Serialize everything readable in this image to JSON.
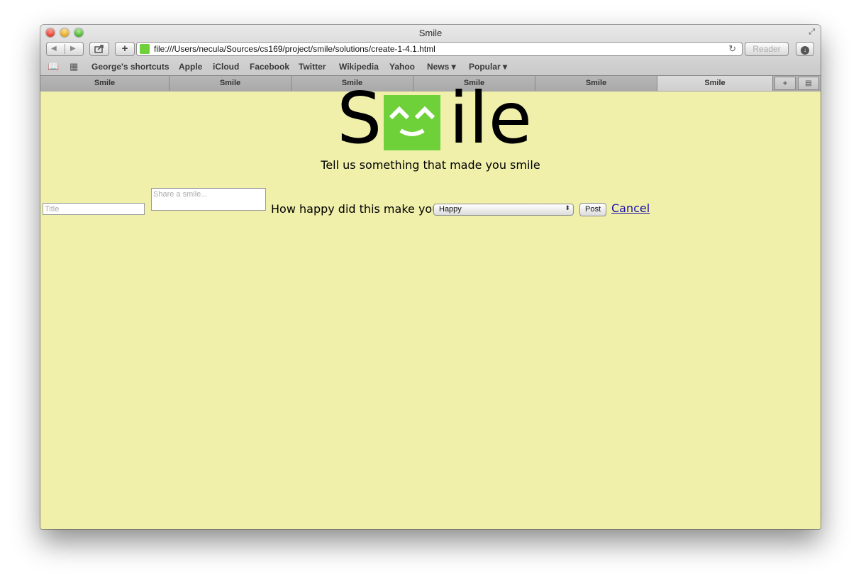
{
  "window": {
    "title": "Smile"
  },
  "toolbar": {
    "url": "file:///Users/necula/Sources/cs169/project/smile/solutions/create-1-4.1.html",
    "reader_label": "Reader"
  },
  "bookmarks": [
    "George's shortcuts",
    "Apple",
    "iCloud",
    "Facebook",
    "Twitter",
    "Wikipedia",
    "Yahoo",
    "News ▾",
    "Popular ▾"
  ],
  "tabs": [
    "Smile",
    "Smile",
    "Smile",
    "Smile",
    "Smile",
    "Smile"
  ],
  "page": {
    "logo_left": "S",
    "logo_right": "ile",
    "subtitle": "Tell us something that made you smile",
    "title_placeholder": "Title",
    "share_placeholder": "Share a smile...",
    "question": "How happy did this make you?",
    "happiness_selected": "Happy",
    "post_label": "Post",
    "cancel_label": "Cancel"
  },
  "colors": {
    "page_background": "#f0f0ab",
    "logo_green": "#6fd13a",
    "link": "#1a0dab"
  },
  "icons": [
    "back-arrow-icon",
    "forward-arrow-icon",
    "share-icon",
    "plus-icon",
    "reload-icon",
    "download-icon",
    "reading-list-icon",
    "top-sites-icon",
    "fullscreen-icon",
    "smile-face-icon"
  ]
}
